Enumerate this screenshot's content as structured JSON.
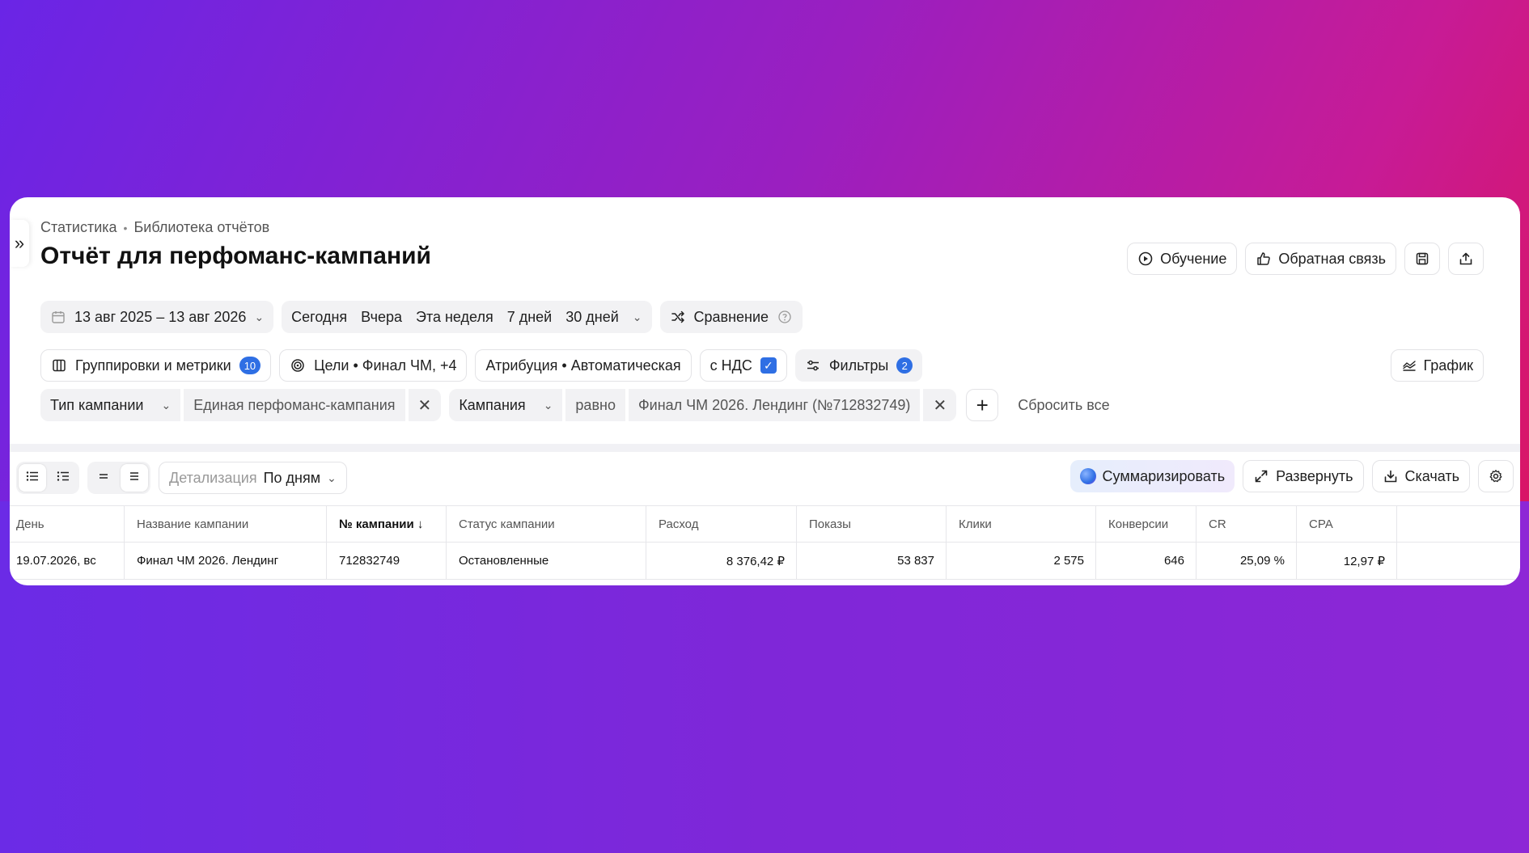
{
  "breadcrumb": [
    "Статистика",
    "Библиотека отчётов"
  ],
  "breadcrumb_sep": "•",
  "title": "Отчёт для перфоманс-кампаний",
  "top_actions": {
    "learn": "Обучение",
    "feedback": "Обратная связь"
  },
  "date_range": "13 авг 2025 – 13 авг 2026",
  "quick_periods": [
    "Сегодня",
    "Вчера",
    "Эта неделя",
    "7 дней",
    "30 дней"
  ],
  "comparison": "Сравнение",
  "row2": {
    "groupings": "Группировки и метрики",
    "groupings_count": "10",
    "goals": "Цели • Финал ЧМ, +4",
    "attribution": "Атрибуция • Автоматическая",
    "vat": "с НДС",
    "filters": "Фильтры",
    "filters_count": "2",
    "graph": "График"
  },
  "filters": {
    "f1_field": "Тип кампании",
    "f1_value": "Единая перфоманс-кампания",
    "f2_field": "Кампания",
    "f2_op": "равно",
    "f2_value": "Финал ЧМ 2026. Лендинг (№712832749)",
    "reset": "Сбросить все"
  },
  "toolbar": {
    "detail_label": "Детализация",
    "detail_value": "По дням",
    "summarize": "Суммаризировать",
    "expand": "Развернуть",
    "download": "Скачать"
  },
  "table": {
    "headers": [
      "День",
      "Название кампании",
      "№ кампании ↓",
      "Статус кампании",
      "Расход",
      "Показы",
      "Клики",
      "Конверсии",
      "CR",
      "CPA"
    ],
    "rows": [
      [
        "19.07.2026, вс",
        "Финал ЧМ 2026. Лендинг",
        "712832749",
        "Остановленные",
        "8 376,42 ₽",
        "53 837",
        "2 575",
        "646",
        "25,09 %",
        "12,97 ₽"
      ]
    ]
  },
  "colors": {
    "accent": "#2f6fe4",
    "bg_start": "#6a25e6",
    "bg_end": "#e2124d"
  }
}
